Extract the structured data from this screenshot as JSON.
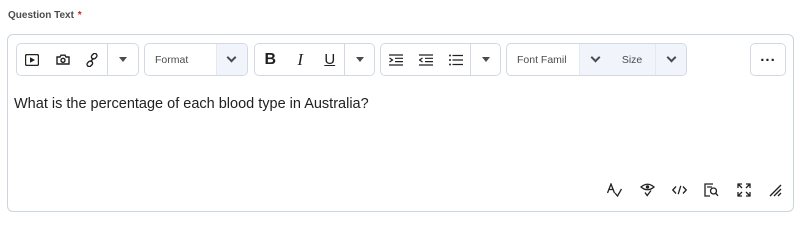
{
  "field": {
    "label": "Question Text",
    "required_mark": "*"
  },
  "toolbar": {
    "insert_media_icon": "video-icon",
    "insert_image_icon": "camera-icon",
    "insert_link_icon": "link-icon",
    "format_select": "Format",
    "bold_label": "B",
    "italic_label": "I",
    "underline_label": "U",
    "font_family_select": "Font Famil",
    "size_select": "Size",
    "more_label": "..."
  },
  "editor": {
    "content": "What is the percentage of each blood type in Australia?"
  },
  "bottom_tools": [
    "spellcheck-icon",
    "preview-icon",
    "source-code-icon",
    "find-icon",
    "fullscreen-icon",
    "resize-handle-icon"
  ]
}
